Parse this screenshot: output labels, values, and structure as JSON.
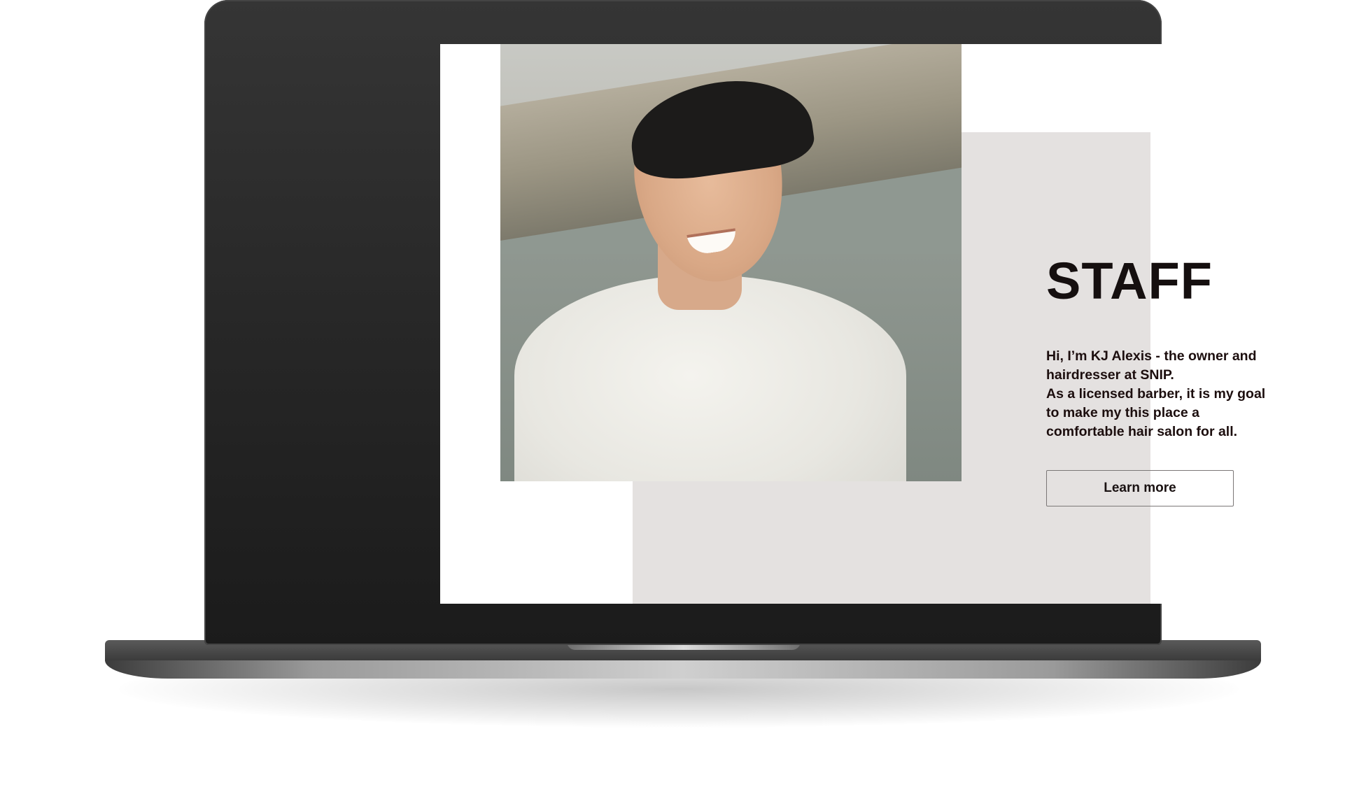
{
  "staff_section": {
    "title": "STAFF",
    "bio_lines": [
      "Hi, I’m KJ Alexis - the owner and",
      "hairdresser at SNIP.",
      "As a licensed barber, it is my goal",
      "to make my this place a",
      "comfortable hair salon for all."
    ],
    "cta_label": "Learn more"
  },
  "colors": {
    "panel_background": "#e4e1e0",
    "text": "#150f0f",
    "button_border": "#7b7777"
  }
}
